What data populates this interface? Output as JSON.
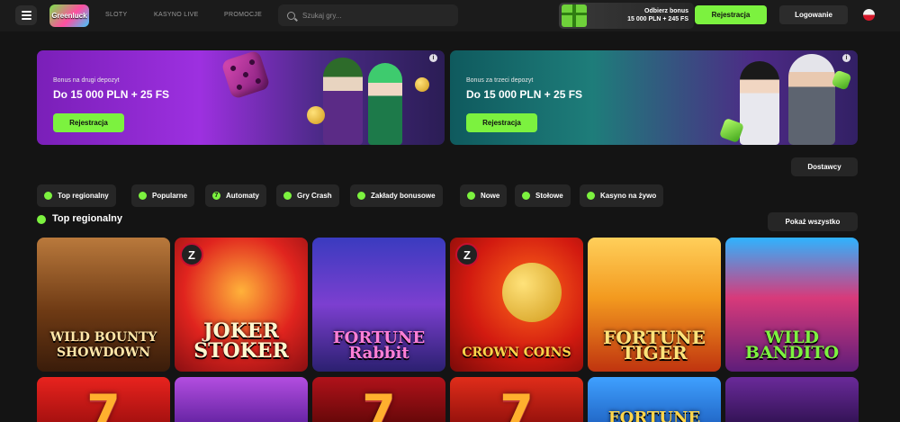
{
  "header": {
    "logo_text": "Greenluck",
    "nav": [
      "SLOTY",
      "KASYNO LIVE",
      "PROMOCJE"
    ],
    "search_placeholder": "Szukaj gry...",
    "bonus_line1": "Odbierz bonus",
    "bonus_line2": "15 000 PLN + 245 FS",
    "register_label": "Rejestracja",
    "login_label": "Logowanie"
  },
  "banners": [
    {
      "subtitle": "Bonus na drugi depozyt",
      "title": "Do 15 000 PLN + 25 FS",
      "button": "Rejestracja"
    },
    {
      "subtitle": "Bonus za trzeci depozyt",
      "title": "Do 15 000 PLN + 25 FS",
      "button": "Rejestracja"
    }
  ],
  "providers_label": "Dostawcy",
  "categories": [
    {
      "label": "Top regionalny",
      "icon": "globe-icon"
    },
    {
      "label": "Popularne",
      "icon": "fire-icon"
    },
    {
      "label": "Automaty",
      "icon": "seven-icon"
    },
    {
      "label": "Gry Crash",
      "icon": "crash-icon"
    },
    {
      "label": "Zakłady bonusowe",
      "icon": "bonus-icon"
    },
    {
      "label": "Nowe",
      "icon": "star-icon"
    },
    {
      "label": "Stołowe",
      "icon": "table-icon"
    },
    {
      "label": "Kasyno na żywo",
      "icon": "live-icon"
    }
  ],
  "section": {
    "title": "Top regionalny",
    "show_all": "Pokaż wszystko"
  },
  "games_row1": [
    {
      "name": "WILD BOUNTY SHOWDOWN",
      "badge": ""
    },
    {
      "name": "JOKER STOKER",
      "badge": "Z"
    },
    {
      "name": "FORTUNE Rabbit",
      "badge": ""
    },
    {
      "name": "CROWN COINS",
      "badge": "Z"
    },
    {
      "name": "FORTUNE TIGER",
      "badge": ""
    },
    {
      "name": "WILD BANDITO",
      "badge": ""
    }
  ],
  "games_row2": [
    {
      "name": ""
    },
    {
      "name": ""
    },
    {
      "name": ""
    },
    {
      "name": ""
    },
    {
      "name": "FORTUNE"
    },
    {
      "name": ""
    }
  ],
  "colors": {
    "accent": "#7cf23f",
    "background": "#141414",
    "surface": "#262626"
  }
}
